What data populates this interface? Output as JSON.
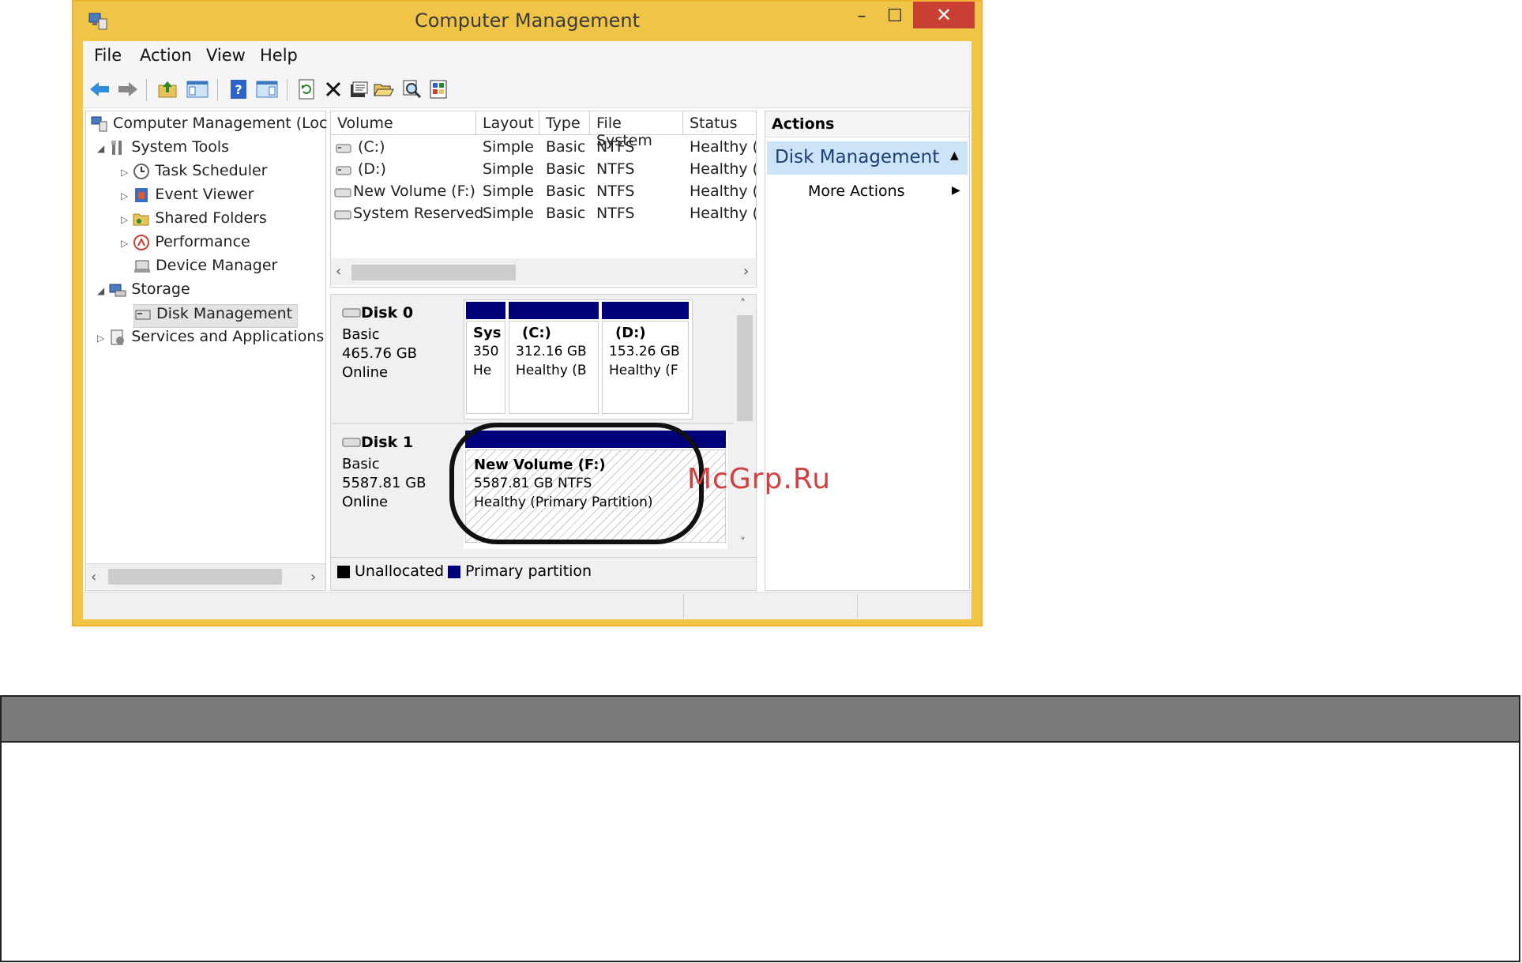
{
  "window": {
    "title": "Computer Management",
    "caption": {
      "minimize": "–",
      "maximize": "☐",
      "close": "✕"
    }
  },
  "menu": [
    {
      "label": "File"
    },
    {
      "label": "Action"
    },
    {
      "label": "View"
    },
    {
      "label": "Help"
    }
  ],
  "toolbar": [
    "back-icon",
    "forward-icon",
    "up-folder-icon",
    "console-tree-icon",
    "help-icon",
    "action-pane-icon",
    "refresh-icon",
    "delete-icon",
    "properties-icon",
    "open-icon",
    "search-icon",
    "settings-icon"
  ],
  "tree": {
    "root": "Computer Management (Loc",
    "items": [
      {
        "label": "System Tools",
        "level": 1,
        "expander": "◢"
      },
      {
        "label": "Task Scheduler",
        "level": 2,
        "expander": "▷"
      },
      {
        "label": "Event Viewer",
        "level": 2,
        "expander": "▷"
      },
      {
        "label": "Shared Folders",
        "level": 2,
        "expander": "▷"
      },
      {
        "label": "Performance",
        "level": 2,
        "expander": "▷"
      },
      {
        "label": "Device Manager",
        "level": 2,
        "expander": ""
      },
      {
        "label": "Storage",
        "level": 1,
        "expander": "◢"
      },
      {
        "label": "Disk Management",
        "level": 2,
        "expander": "",
        "selected": true
      },
      {
        "label": "Services and Applications",
        "level": 1,
        "expander": "▷"
      }
    ]
  },
  "volumes": {
    "columns": [
      "Volume",
      "Layout",
      "Type",
      "File System",
      "Status"
    ],
    "rows": [
      [
        "(C:)",
        "Simple",
        "Basic",
        "NTFS",
        "Healthy (E"
      ],
      [
        "(D:)",
        "Simple",
        "Basic",
        "NTFS",
        "Healthy (F"
      ],
      [
        "New Volume (F:)",
        "Simple",
        "Basic",
        "NTFS",
        "Healthy (F"
      ],
      [
        "System Reserved",
        "Simple",
        "Basic",
        "NTFS",
        "Healthy (S"
      ]
    ]
  },
  "disks": {
    "disk0": {
      "name": "Disk 0",
      "type": "Basic",
      "size": "465.76 GB",
      "state": "Online",
      "partitions": [
        {
          "name": "Sys",
          "size": "350",
          "status": "He"
        },
        {
          "name": "(C:)",
          "size": "312.16 GB",
          "status": "Healthy (B"
        },
        {
          "name": "(D:)",
          "size": "153.26 GB",
          "status": "Healthy (F"
        }
      ]
    },
    "disk1": {
      "name": "Disk 1",
      "type": "Basic",
      "size": "5587.81 GB",
      "state": "Online",
      "partition": {
        "name": "New Volume  (F:)",
        "size": "5587.81 GB NTFS",
        "status": "Healthy (Primary Partition)"
      }
    },
    "legend": {
      "unallocated": "Unallocated",
      "primary": "Primary partition"
    }
  },
  "actions": {
    "header": "Actions",
    "section": "Disk Management",
    "more": "More Actions"
  },
  "watermark": "McGrp.Ru",
  "colors": {
    "window_frame": "#f0c447",
    "close_button": "#c74032",
    "partition_header": "#00007b",
    "actions_selected": "#cde4f7",
    "panel_header": "#7b7a7a"
  }
}
